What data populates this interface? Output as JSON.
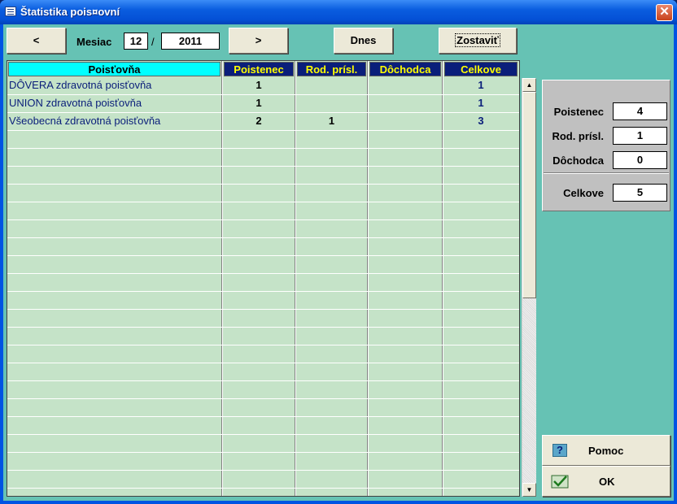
{
  "window": {
    "title": "Štatistika pois¤ovní",
    "close_glyph": "✕"
  },
  "nav": {
    "prev_label": "<",
    "next_label": ">",
    "month_label": "Mesiac",
    "month_value": "12",
    "separator": "/",
    "year_value": "2011",
    "today_label": "Dnes",
    "build_label": "Zostaviť"
  },
  "grid": {
    "columns": [
      "Poisťovňa",
      "Poistenec",
      "Rod. prísl.",
      "Dôchodca",
      "Celkove"
    ],
    "rows": [
      {
        "name": "DÔVERA zdravotná poisťovňa",
        "poistenec": "1",
        "rod": "",
        "doch": "",
        "celk": "1"
      },
      {
        "name": "UNION zdravotná poisťovňa",
        "poistenec": "1",
        "rod": "",
        "doch": "",
        "celk": "1"
      },
      {
        "name": "Všeobecná zdravotná poisťovňa",
        "poistenec": "2",
        "rod": "1",
        "doch": "",
        "celk": "3"
      }
    ],
    "empty_rows": 20
  },
  "summary": {
    "poistenec_label": "Poistenec",
    "poistenec_value": "4",
    "rod_label": "Rod. prísl.",
    "rod_value": "1",
    "doch_label": "Dôchodca",
    "doch_value": "0",
    "celk_label": "Celkove",
    "celk_value": "5"
  },
  "buttons": {
    "help_label": "Pomoc",
    "ok_label": "OK",
    "help_glyph": "?"
  },
  "scrollbar": {
    "up_glyph": "▲",
    "down_glyph": "▼"
  }
}
